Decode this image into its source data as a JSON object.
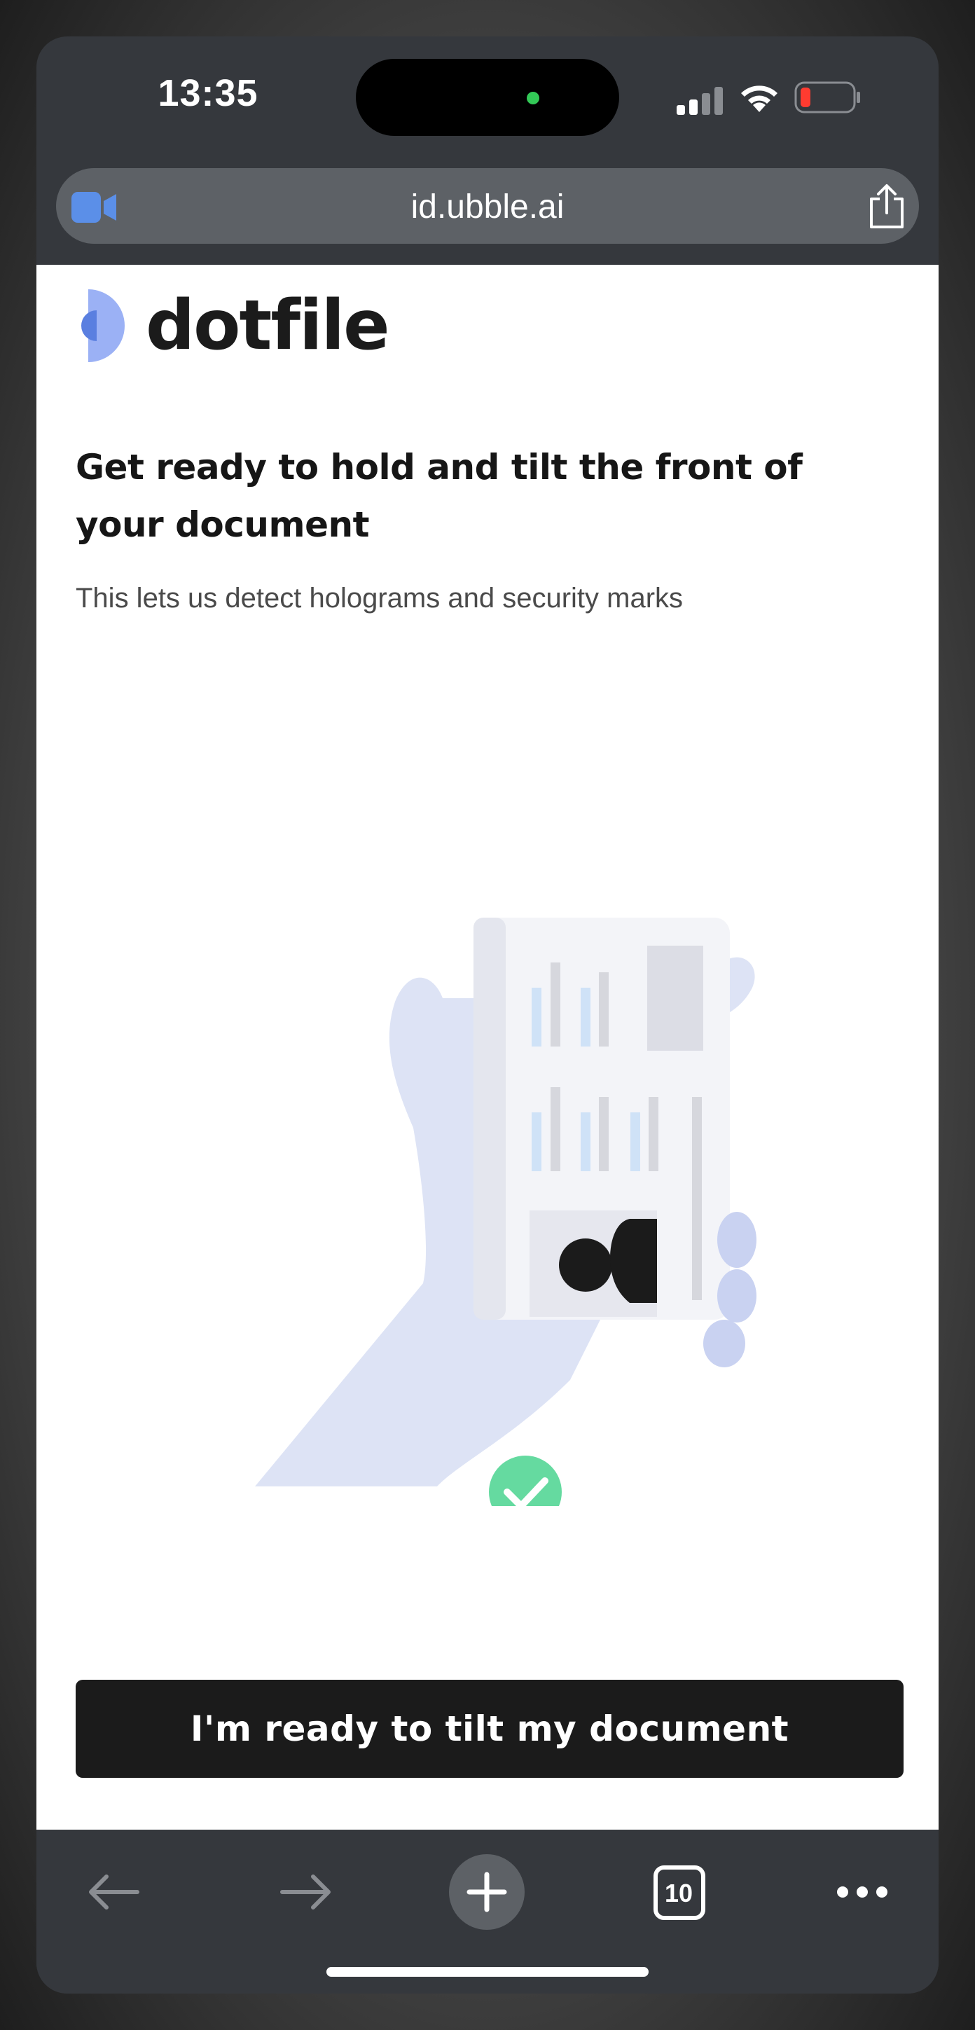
{
  "status": {
    "time": "13:35"
  },
  "browser": {
    "url": "id.ubble.ai"
  },
  "page": {
    "brand": "dotfile",
    "heading": "Get ready to hold and tilt the front of your document",
    "subtitle": "This lets us detect holograms and security marks",
    "cta_label": "I'm ready to tilt my document"
  },
  "toolbar": {
    "tabs_count": "10"
  },
  "colors": {
    "brand_blue": "#8fa8f5",
    "check_green": "#4ad48f",
    "button_bg": "#1b1b1b",
    "chrome": "#35383d"
  }
}
